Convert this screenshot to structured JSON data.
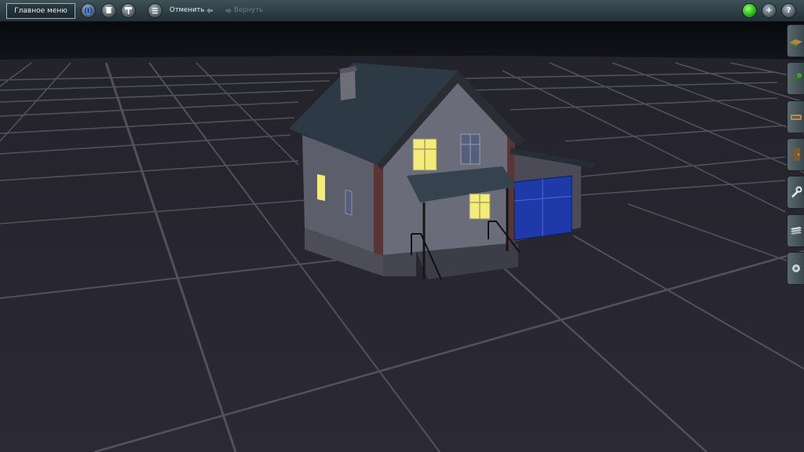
{
  "toolbar": {
    "main_menu_label": "Главное меню",
    "undo_label": "Отменить",
    "redo_label": "Вернуть",
    "left_icons": [
      "globe-icon",
      "trash-icon",
      "paint-roller-icon",
      "list-icon"
    ],
    "right_icons": [
      "green-indicator-icon",
      "add-icon",
      "help-icon"
    ],
    "add_glyph": "+",
    "help_glyph": "?"
  },
  "side_panel": {
    "tabs": [
      "landscape-tool-icon",
      "plants-tool-icon",
      "objects-tool-icon",
      "doors-tool-icon",
      "tools-icon",
      "materials-icon",
      "settings-icon"
    ]
  },
  "colors": {
    "toolbar": "#2e3e46",
    "ground": "#2a2833",
    "grid_line": "#5a5862",
    "window_light": "#f4ec7a",
    "garage_door": "#1e3aa8",
    "roof": "#2d3944",
    "wall": "#6a6c79",
    "indicator": "#2fb81e"
  }
}
